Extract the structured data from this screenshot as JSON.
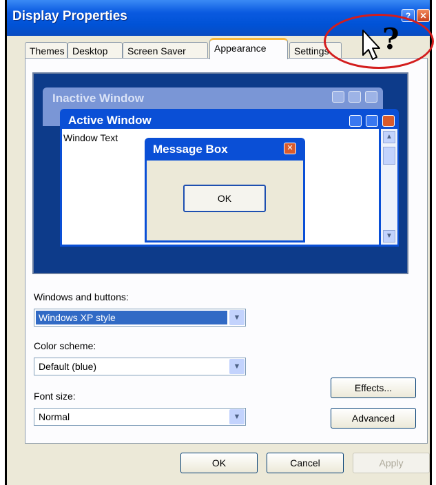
{
  "window": {
    "title": "Display Properties",
    "help_glyph": "?",
    "close_glyph": "✕"
  },
  "tabs": [
    {
      "label": "Themes",
      "active": false
    },
    {
      "label": "Desktop",
      "active": false
    },
    {
      "label": "Screen Saver",
      "active": false
    },
    {
      "label": "Appearance",
      "active": true
    },
    {
      "label": "Settings",
      "active": false
    }
  ],
  "preview": {
    "inactive_title": "Inactive Window",
    "active_title": "Active Window",
    "window_text": "Window Text",
    "message_title": "Message Box",
    "message_ok": "OK"
  },
  "fields": {
    "windows_buttons": {
      "label": "Windows and buttons:",
      "value": "Windows XP style"
    },
    "color_scheme": {
      "label": "Color scheme:",
      "value": "Default (blue)"
    },
    "font_size": {
      "label": "Font size:",
      "value": "Normal"
    }
  },
  "buttons": {
    "effects": "Effects...",
    "advanced": "Advanced",
    "ok": "OK",
    "cancel": "Cancel",
    "apply": "Apply"
  },
  "annotation": {
    "glyph": "?"
  },
  "colors": {
    "titlebar": "#0052d6",
    "dialog": "#ece9d8",
    "preview_bg": "#0d3b8a",
    "annotation": "#d31d1d"
  }
}
